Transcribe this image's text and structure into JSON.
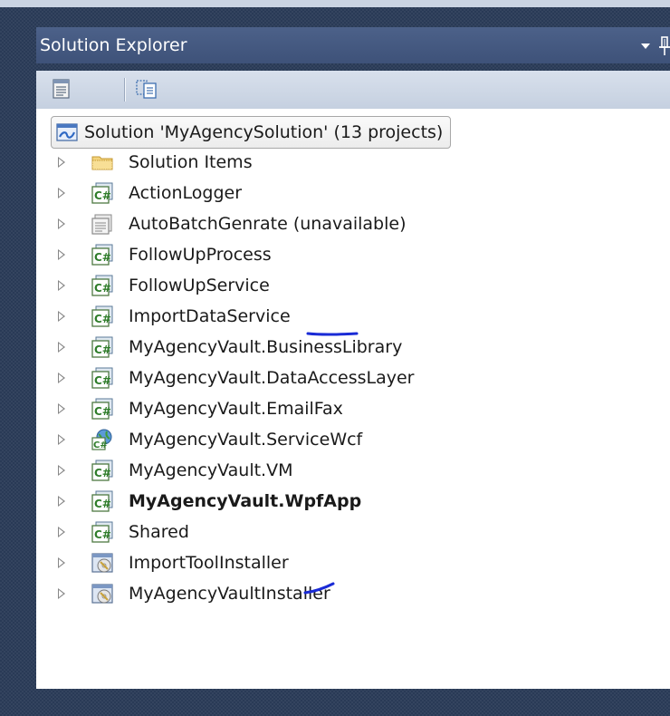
{
  "window": {
    "title": "Solution Explorer"
  },
  "toolbar": {
    "buttons": [
      {
        "icon": "properties-icon"
      },
      {
        "icon": "show-all-files-icon"
      }
    ]
  },
  "tree": {
    "root": {
      "label": "Solution 'MyAgencySolution' (13 projects)",
      "icon": "solution-icon"
    },
    "items": [
      {
        "label": "Solution Items",
        "icon": "folder-icon",
        "bold": false
      },
      {
        "label": "ActionLogger",
        "icon": "csharp-project-icon",
        "bold": false
      },
      {
        "label": "AutoBatchGenrate (unavailable)",
        "icon": "unavailable-project-icon",
        "bold": false
      },
      {
        "label": "FollowUpProcess",
        "icon": "csharp-project-icon",
        "bold": false
      },
      {
        "label": "FollowUpService",
        "icon": "csharp-project-icon",
        "bold": false
      },
      {
        "label": "ImportDataService",
        "icon": "csharp-project-icon",
        "bold": false
      },
      {
        "label": "MyAgencyVault.BusinessLibrary",
        "icon": "csharp-project-icon",
        "bold": false
      },
      {
        "label": "MyAgencyVault.DataAccessLayer",
        "icon": "csharp-project-icon",
        "bold": false
      },
      {
        "label": "MyAgencyVault.EmailFax",
        "icon": "csharp-project-icon",
        "bold": false
      },
      {
        "label": "MyAgencyVault.ServiceWcf",
        "icon": "csharp-web-project-icon",
        "bold": false
      },
      {
        "label": "MyAgencyVault.VM",
        "icon": "csharp-project-icon",
        "bold": false
      },
      {
        "label": "MyAgencyVault.WpfApp",
        "icon": "csharp-project-icon",
        "bold": true
      },
      {
        "label": "Shared",
        "icon": "csharp-project-icon",
        "bold": false
      },
      {
        "label": "ImportToolInstaller",
        "icon": "setup-project-icon",
        "bold": false
      },
      {
        "label": "MyAgencyVaultInstaller",
        "icon": "setup-project-icon",
        "bold": false
      }
    ]
  },
  "colors": {
    "title_bar": "#4c6189",
    "toolbar": "#d0d9e7",
    "background": "#293a56",
    "annotation_ink": "#1a2bd6"
  }
}
